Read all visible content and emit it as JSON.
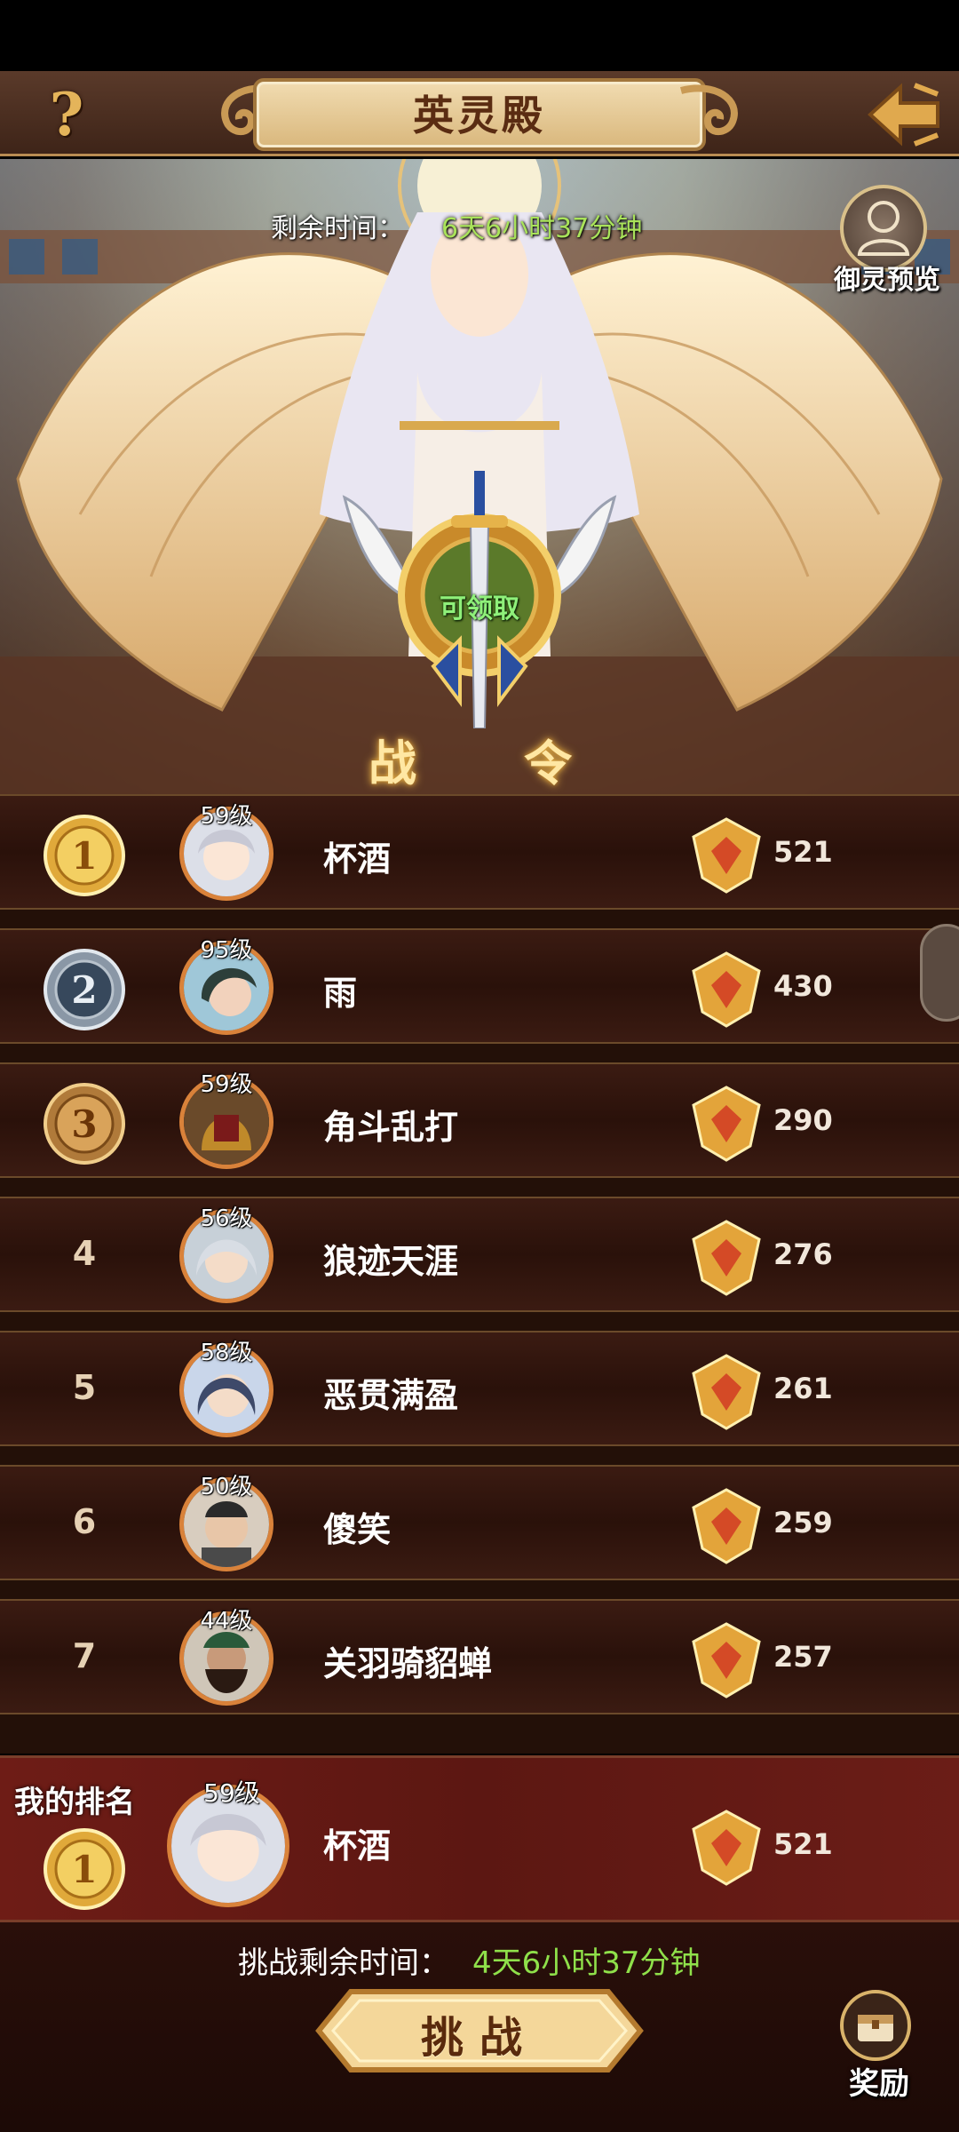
{
  "header": {
    "title": "英灵殿",
    "help_icon": "question-mark-icon",
    "back_icon": "back-arrow-icon"
  },
  "banner": {
    "timer_label": "剩余时间：",
    "timer_value": "6天6小时37分钟",
    "preview_label": "御灵预览",
    "claim_label": "可领取",
    "pass_label_left": "战",
    "pass_label_right": "令"
  },
  "ranking": {
    "rows": [
      {
        "rank": "1",
        "level": "59级",
        "name": "杯酒",
        "score": "521"
      },
      {
        "rank": "2",
        "level": "95级",
        "name": "雨",
        "score": "430"
      },
      {
        "rank": "3",
        "level": "59级",
        "name": "角斗乱打",
        "score": "290"
      },
      {
        "rank": "4",
        "level": "56级",
        "name": "狼迹天涯",
        "score": "276"
      },
      {
        "rank": "5",
        "level": "58级",
        "name": "恶贯满盈",
        "score": "261"
      },
      {
        "rank": "6",
        "level": "50级",
        "name": "傻笑",
        "score": "259"
      },
      {
        "rank": "7",
        "level": "44级",
        "name": "关羽骑貂蝉",
        "score": "257"
      }
    ]
  },
  "my_rank": {
    "label": "我的排名",
    "rank": "1",
    "level": "59级",
    "name": "杯酒",
    "score": "521"
  },
  "footer": {
    "challenge_time_label": "挑战剩余时间：",
    "challenge_time_value": "4天6小时37分钟",
    "challenge_button": "挑战",
    "reward_label": "奖励"
  },
  "colors": {
    "gold": "#e4b45a",
    "timer_green": "#a9e35a",
    "row_bg": "#2a110a",
    "my_rank_bg": "#5c1712"
  }
}
